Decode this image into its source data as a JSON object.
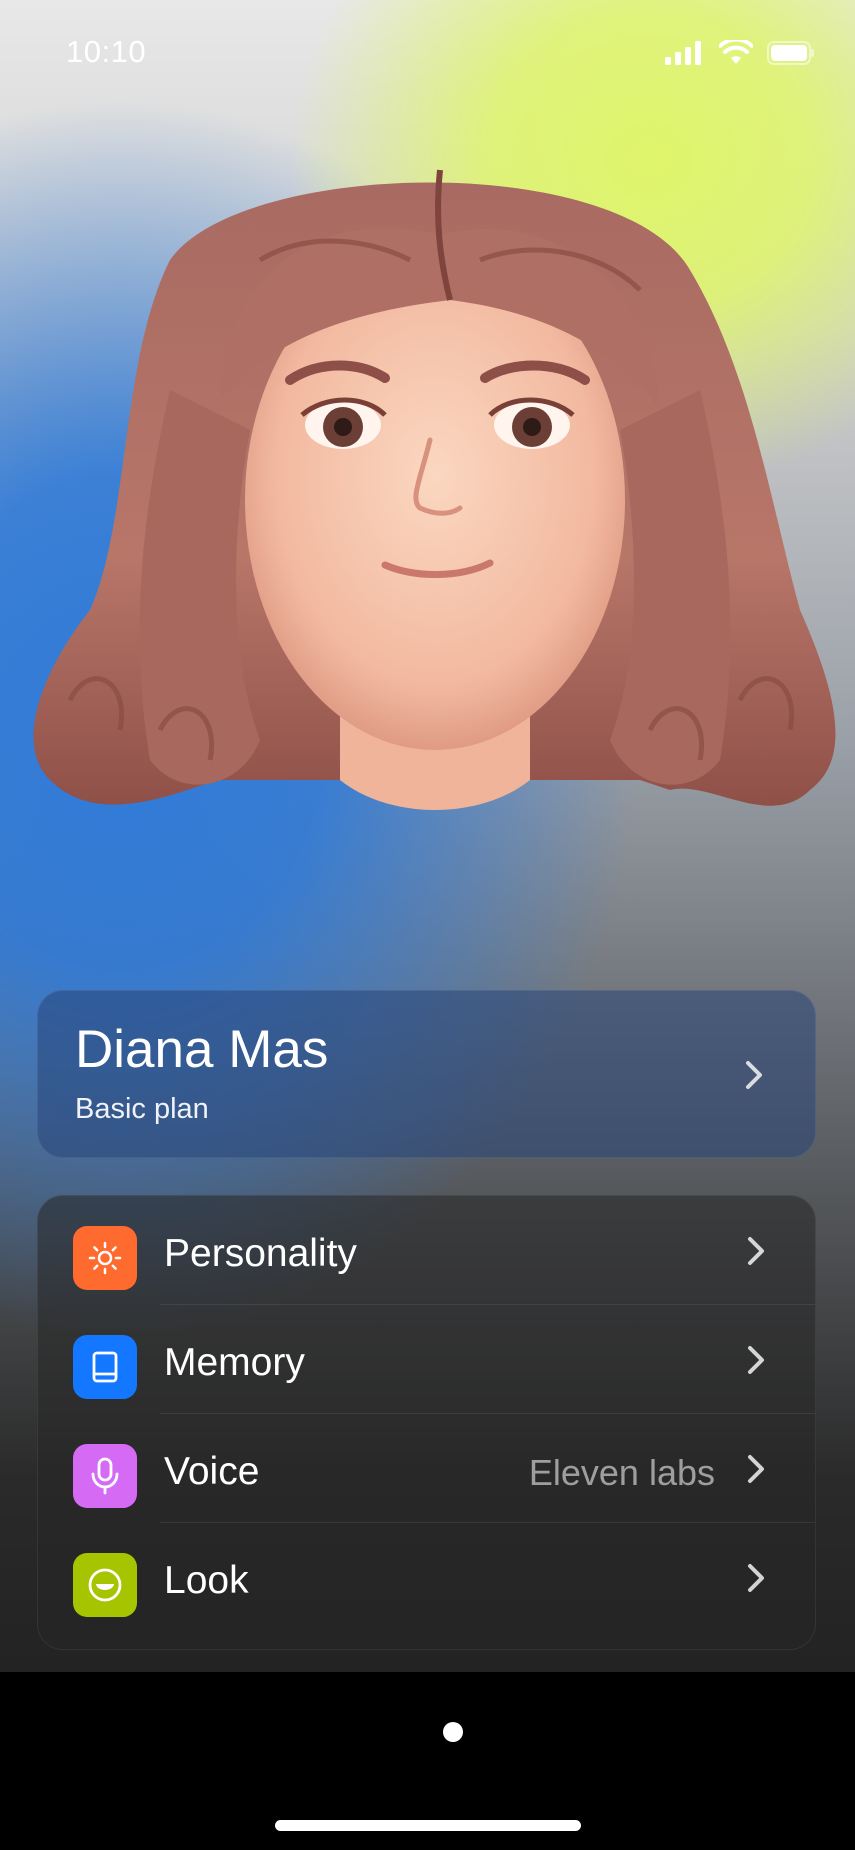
{
  "status_bar": {
    "time": "10:10",
    "icons": [
      "cellular-signal-icon",
      "wifi-icon",
      "battery-icon"
    ]
  },
  "avatar": {
    "icon": "avatar-3d-portrait"
  },
  "profile": {
    "name": "Diana Mas",
    "plan": "Basic plan"
  },
  "settings": {
    "items": [
      {
        "label": "Personality",
        "value": "",
        "icon": "sun-icon",
        "color": "#ff6a2f"
      },
      {
        "label": "Memory",
        "value": "",
        "icon": "book-icon",
        "color": "#1477ff"
      },
      {
        "label": "Voice",
        "value": "Eleven labs",
        "icon": "microphone-icon",
        "color": "#d56af5"
      },
      {
        "label": "Look",
        "value": "",
        "icon": "smiley-face-icon",
        "color": "#a6c400"
      }
    ]
  },
  "bottom_nav": {
    "page_indicator": "page-dot"
  }
}
